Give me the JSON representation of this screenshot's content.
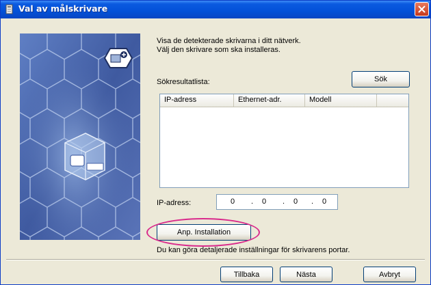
{
  "window": {
    "title": "Val av målskrivare"
  },
  "intro": {
    "line1": "Visa de detekterade skrivarna i ditt nätverk.",
    "line2": "Välj den skrivare som ska installeras."
  },
  "search": {
    "label": "Sökresultatlista:",
    "button_label": "Sök"
  },
  "results_table": {
    "columns": [
      "IP-adress",
      "Ethernet-adr.",
      "Modell",
      ""
    ],
    "rows": []
  },
  "ip": {
    "label": "IP-adress:",
    "octets": [
      "0",
      "0",
      "0",
      "0"
    ],
    "separator": "."
  },
  "advanced": {
    "button_label": "Anp. Installation",
    "description": "Du kan göra detaljerade inställningar för skrivarens portar."
  },
  "footer": {
    "back_label": "Tillbaka",
    "next_label": "Nästa",
    "cancel_label": "Avbryt"
  },
  "colors": {
    "titlebar": "#0351d8",
    "dialog_bg": "#ece9d8",
    "panel_bg": "#4d69ad",
    "highlight": "#d9298b",
    "close_button": "#c5391b"
  }
}
